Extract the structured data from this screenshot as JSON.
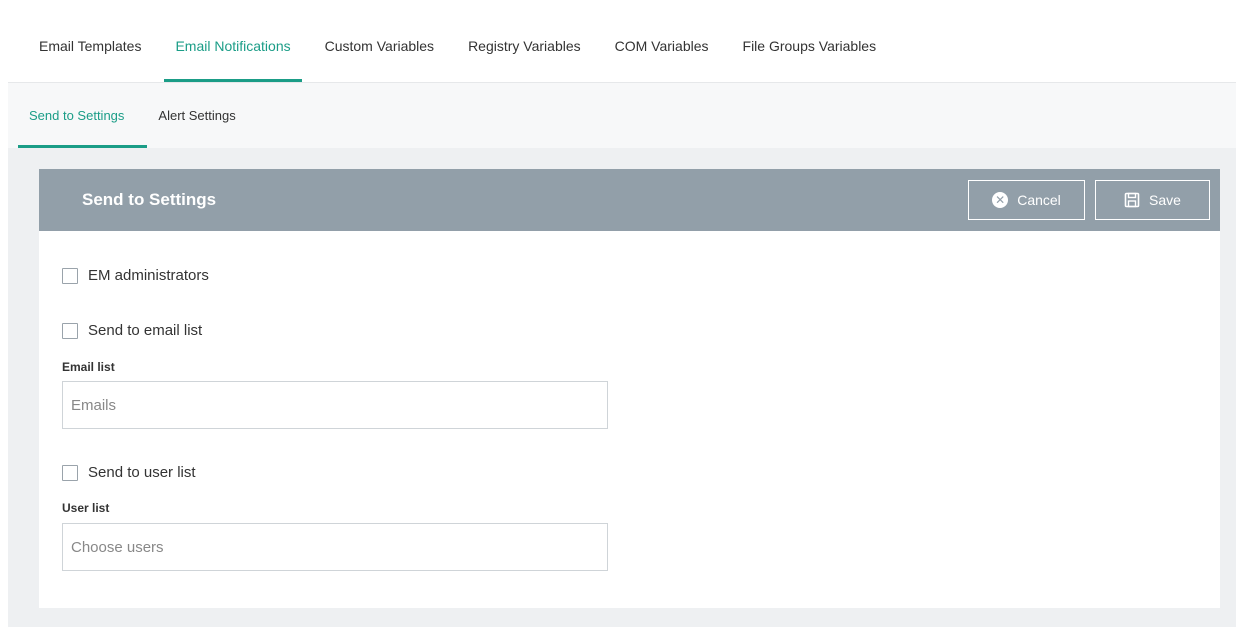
{
  "top_tabs": [
    {
      "label": "Email Templates",
      "active": false
    },
    {
      "label": "Email Notifications",
      "active": true
    },
    {
      "label": "Custom Variables",
      "active": false
    },
    {
      "label": "Registry Variables",
      "active": false
    },
    {
      "label": "COM Variables",
      "active": false
    },
    {
      "label": "File Groups Variables",
      "active": false
    }
  ],
  "sub_tabs": [
    {
      "label": "Send to Settings",
      "active": true
    },
    {
      "label": "Alert Settings",
      "active": false
    }
  ],
  "panel": {
    "title": "Send to Settings",
    "cancel_label": "Cancel",
    "save_label": "Save",
    "cancel_icon": "x-circle-icon",
    "save_icon": "floppy-disk-icon"
  },
  "form": {
    "em_admins_label": "EM administrators",
    "send_email_list_label": "Send to email list",
    "email_list_label": "Email list",
    "email_list_placeholder": "Emails",
    "send_user_list_label": "Send to user list",
    "user_list_label": "User list",
    "user_list_placeholder": "Choose users"
  },
  "colors": {
    "accent": "#1b9d87",
    "header_bg": "#929fa9"
  }
}
